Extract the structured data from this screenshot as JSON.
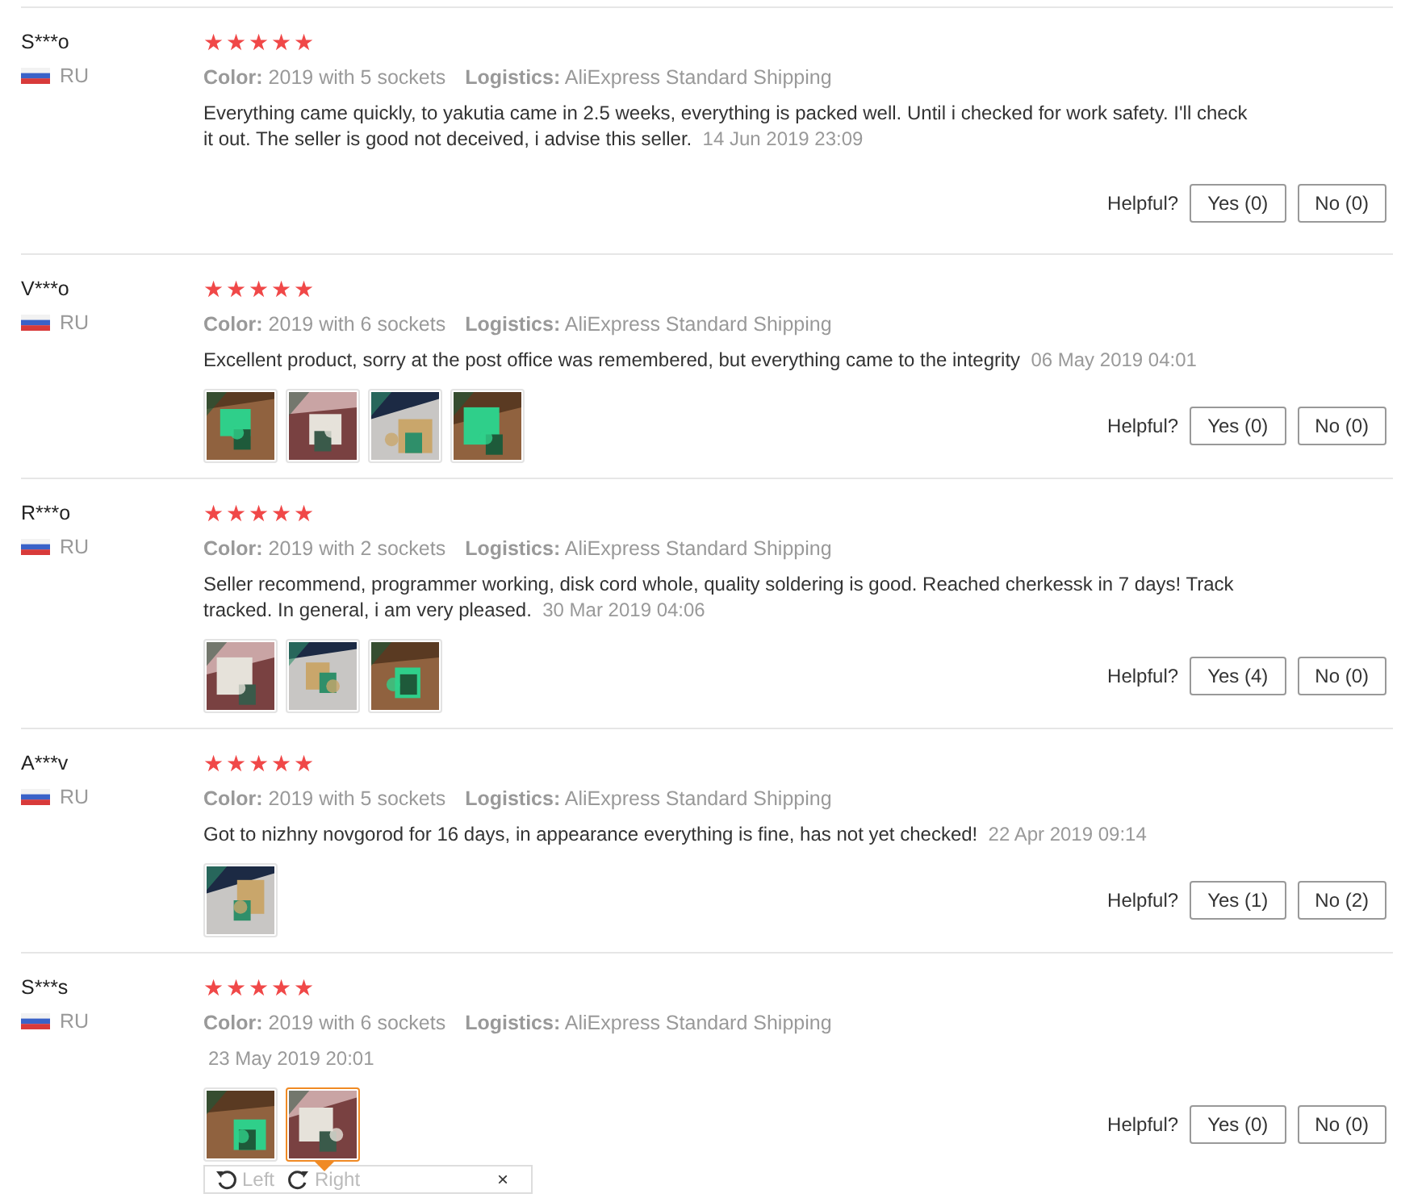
{
  "reviews": [
    {
      "name": "S***o",
      "country": "RU",
      "stars": 5,
      "color_label": "Color:",
      "option": "2019 with 5 sockets",
      "logistics_label": "Logistics:",
      "logistics": "AliExpress Standard Shipping",
      "text": "Everything came quickly, to yakutia came in 2.5 weeks, everything is packed well. Until i checked for work safety. I'll check it out. The seller is good not deceived, i advise this seller.",
      "date": "14 Jun 2019 23:09",
      "helpful_label": "Helpful?",
      "yes": "Yes (0)",
      "no": "No (0)"
    },
    {
      "name": "V***o",
      "country": "RU",
      "stars": 5,
      "color_label": "Color:",
      "option": "2019 with 6 sockets",
      "logistics_label": "Logistics:",
      "logistics": "AliExpress Standard Shipping",
      "text": "Excellent product, sorry at the post office was remembered, but everything came to the integrity",
      "date": "06 May 2019 04:01",
      "photos": [
        {
          "kind": "picture",
          "selected": false
        },
        {
          "kind": "picture",
          "selected": false
        },
        {
          "kind": "picture",
          "selected": false
        },
        {
          "kind": "picture",
          "selected": false
        }
      ],
      "helpful_label": "Helpful?",
      "yes": "Yes (0)",
      "no": "No (0)"
    },
    {
      "name": "R***o",
      "country": "RU",
      "stars": 5,
      "color_label": "Color:",
      "option": "2019 with 2 sockets",
      "logistics_label": "Logistics:",
      "logistics": "AliExpress Standard Shipping",
      "text": "Seller recommend, programmer working, disk cord whole, quality soldering is good. Reached cherkessk in 7 days! Track tracked. In general, i am very pleased.",
      "date": "30 Mar 2019 04:06",
      "photos": [
        {
          "kind": "picture",
          "selected": false
        },
        {
          "kind": "picture",
          "selected": false
        },
        {
          "kind": "picture",
          "selected": false
        }
      ],
      "helpful_label": "Helpful?",
      "yes": "Yes (4)",
      "no": "No (0)"
    },
    {
      "name": "A***v",
      "country": "RU",
      "stars": 5,
      "color_label": "Color:",
      "option": "2019 with 5 sockets",
      "logistics_label": "Logistics:",
      "logistics": "AliExpress Standard Shipping",
      "text": "Got to nizhny novgorod for 16 days, in appearance everything is fine, has not yet checked!",
      "date": "22 Apr 2019 09:14",
      "photos": [
        {
          "kind": "picture",
          "selected": false
        }
      ],
      "helpful_label": "Helpful?",
      "yes": "Yes (1)",
      "no": "No (2)"
    },
    {
      "name": "S***s",
      "country": "RU",
      "stars": 5,
      "color_label": "Color:",
      "option": "2019 with 6 sockets",
      "logistics_label": "Logistics:",
      "logistics": "AliExpress Standard Shipping",
      "date": "23 May 2019 20:01",
      "photos": [
        {
          "kind": "picture",
          "selected": false
        },
        {
          "kind": "picture",
          "selected": true
        }
      ],
      "viewer": {
        "left": "Left",
        "right": "Right",
        "close": "×"
      },
      "helpful_label": "Helpful?",
      "yes": "Yes (0)",
      "no": "No (0)"
    }
  ]
}
